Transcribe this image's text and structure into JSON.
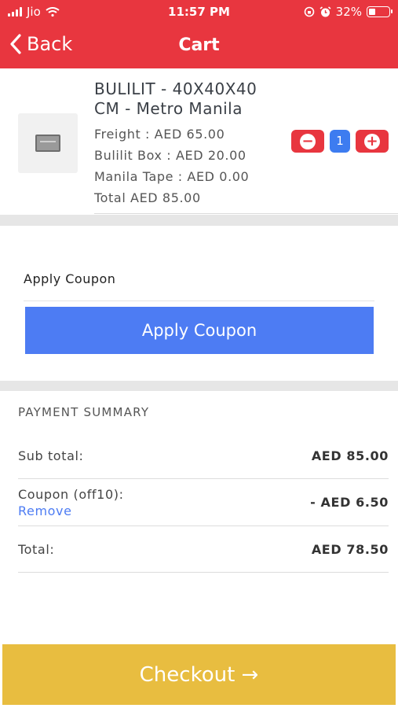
{
  "status_bar": {
    "carrier": "Jio",
    "time": "11:57 PM",
    "battery": "32%",
    "battery_level": 0.32,
    "icons": [
      "signal-icon",
      "wifi-icon",
      "rotation-lock-icon",
      "alarm-icon",
      "battery-icon"
    ]
  },
  "nav": {
    "back_label": "Back",
    "title": "Cart"
  },
  "cart_item": {
    "name": "BULILIT - 40X40X40 CM - Metro Manila",
    "lines": [
      "Freight : AED 65.00",
      "Bulilit Box : AED 20.00",
      "Manila Tape : AED 0.00",
      "Total AED 85.00"
    ],
    "quantity": "1",
    "decrement_symbol": "−",
    "increment_symbol": "+"
  },
  "coupon": {
    "label": "Apply Coupon",
    "button_label": "Apply Coupon"
  },
  "summary": {
    "title": "PAYMENT SUMMARY",
    "subtotal_label": "Sub total:",
    "subtotal_value": "AED 85.00",
    "coupon_label": "Coupon (off10):",
    "remove_label": "Remove",
    "coupon_value": "- AED 6.50",
    "total_label": "Total:",
    "total_value": "AED 78.50"
  },
  "checkout": {
    "label": "Checkout →"
  },
  "colors": {
    "primary_red": "#e8363f",
    "coupon_blue": "#4d7cf3",
    "qty_blue": "#3d7cf0",
    "checkout_yellow": "#e8bd40",
    "separator_gray": "#e6e6e6"
  }
}
